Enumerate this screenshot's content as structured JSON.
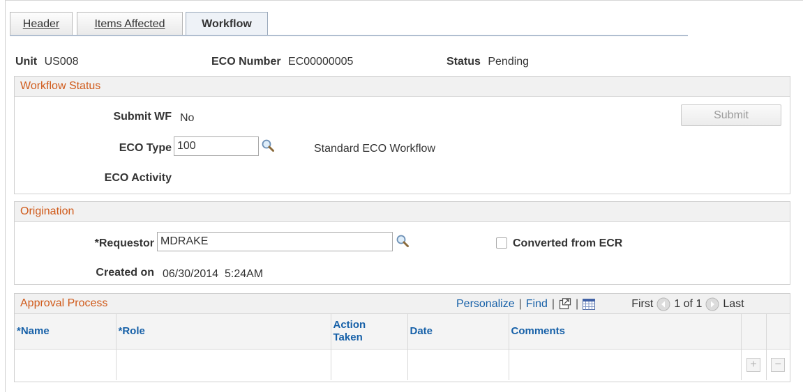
{
  "tabs": [
    {
      "accel": "H",
      "rest": "eader",
      "active": false
    },
    {
      "accel": "I",
      "rest": "tems Affected",
      "active": false
    },
    {
      "accel": "",
      "rest": "Workflow",
      "active": true
    }
  ],
  "keys": {
    "unit_label": "Unit",
    "unit_value": "US008",
    "eco_label": "ECO Number",
    "eco_value": "EC00000005",
    "status_label": "Status",
    "status_value": "Pending"
  },
  "workflow_status": {
    "title": "Workflow Status",
    "submit_wf_label": "Submit WF",
    "submit_wf_value": "No",
    "submit_button": "Submit",
    "eco_type_label": "ECO Type",
    "eco_type_value": "100",
    "eco_type_desc": "Standard ECO Workflow",
    "eco_activity_label": "ECO Activity"
  },
  "origination": {
    "title": "Origination",
    "requestor_label": "*Requestor",
    "requestor_value": "MDRAKE",
    "converted_label": "Converted from ECR",
    "created_label": "Created on",
    "created_value": "06/30/2014  5:24AM"
  },
  "approval": {
    "title": "Approval Process",
    "personalize": "Personalize",
    "find": "Find",
    "first": "First",
    "range": "1 of 1",
    "last": "Last",
    "columns": {
      "name": "*Name",
      "role": "*Role",
      "action_1": "Action",
      "action_2": "Taken",
      "date": "Date",
      "comments": "Comments"
    },
    "add_symbol": "+",
    "delete_symbol": "−"
  }
}
